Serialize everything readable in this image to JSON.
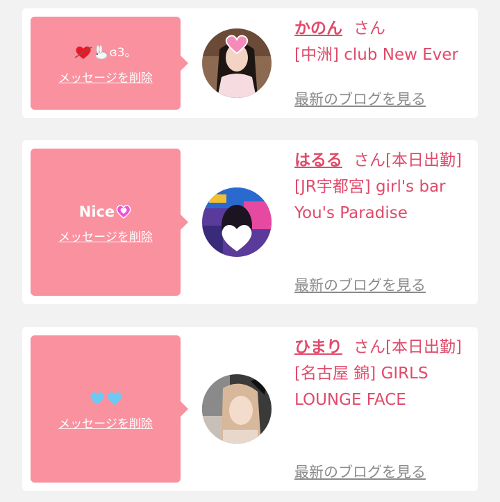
{
  "cards": [
    {
      "message": "❤️‍🔥🐇c3。",
      "delete_label": "メッセージを削除",
      "name": "かのん",
      "honorific": "さん",
      "shop": "[中洲] club New Ever",
      "blog_link": "最新のブログを見る"
    },
    {
      "message": "Nice💞",
      "delete_label": "メッセージを削除",
      "name": "はるる",
      "honorific": "さん[本日出勤]",
      "shop": "[JR宇都宮] girl's bar You's Paradise",
      "blog_link": "最新のブログを見る"
    },
    {
      "message": "🩵🩵",
      "delete_label": "メッセージを削除",
      "name": "ひまり",
      "honorific": "さん[本日出勤]",
      "shop": "[名古屋 錦] GIRLS LOUNGE FACE",
      "blog_link": "最新のブログを見る"
    }
  ],
  "colors": {
    "bubble": "#f9919f",
    "name": "#e04a6a",
    "link_gray": "#8a8a8a",
    "background": "#f2f2f2"
  }
}
